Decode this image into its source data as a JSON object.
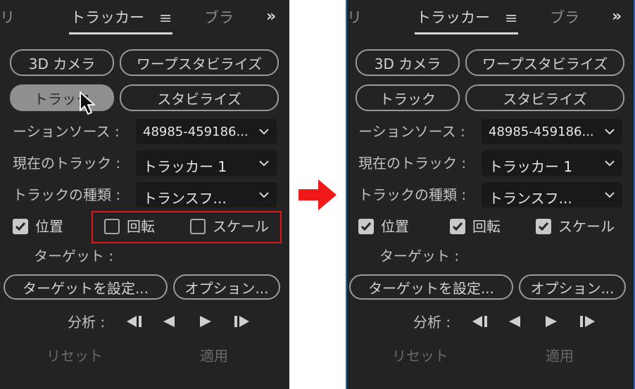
{
  "before": {
    "tabs": {
      "left_partial": "リ",
      "active": "トラッカー",
      "next_partial": "ブラ",
      "overflow": "»"
    },
    "buttons": {
      "camera": "3D カメラ",
      "warp": "ワープスタビライズ",
      "track": "トラック",
      "stabilize": "スタビライズ"
    },
    "rows": [
      {
        "label": "ーションソース :",
        "value": "48985-459186..."
      },
      {
        "label": "現在のトラック :",
        "value": "トラッカー 1"
      },
      {
        "label": "トラックの種類 :",
        "value": "トランスフ..."
      }
    ],
    "checks": [
      {
        "label": "位置",
        "checked": true
      },
      {
        "label": "回転",
        "checked": false
      },
      {
        "label": "スケール",
        "checked": false
      }
    ],
    "target_label": "ターゲット :",
    "set_target": "ターゲットを設定...",
    "options": "オプション...",
    "analyze_label": "分析 :",
    "reset": "リセット",
    "apply": "適用"
  },
  "after": {
    "tabs": {
      "left_partial": "リ",
      "active": "トラッカー",
      "next_partial": "ブラ",
      "overflow": "»"
    },
    "buttons": {
      "camera": "3D カメラ",
      "warp": "ワープスタビライズ",
      "track": "トラック",
      "stabilize": "スタビライズ"
    },
    "rows": [
      {
        "label": "ーションソース :",
        "value": "48985-459186..."
      },
      {
        "label": "現在のトラック :",
        "value": "トラッカー 1"
      },
      {
        "label": "トラックの種類 :",
        "value": "トランスフ..."
      }
    ],
    "checks": [
      {
        "label": "位置",
        "checked": true
      },
      {
        "label": "回転",
        "checked": true
      },
      {
        "label": "スケール",
        "checked": true
      }
    ],
    "target_label": "ターゲット :",
    "set_target": "ターゲットを設定...",
    "options": "オプション...",
    "analyze_label": "分析 :",
    "reset": "リセット",
    "apply": "適用"
  },
  "colors": {
    "panel_bg": "#232323",
    "highlight_red": "#e01a1a",
    "arrow_red": "#f01818",
    "after_border": "#2e5fa8"
  }
}
